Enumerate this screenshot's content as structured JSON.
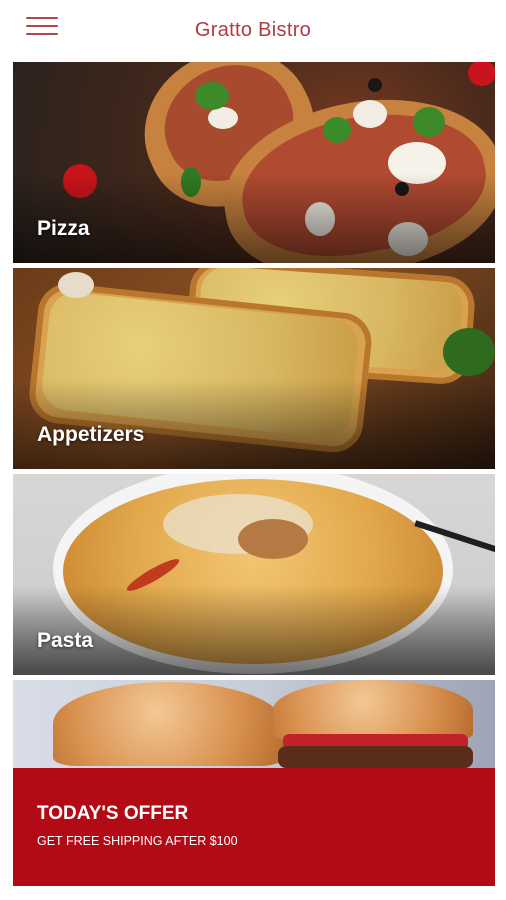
{
  "app": {
    "title": "Gratto Bistro"
  },
  "categories": [
    {
      "label": "Pizza"
    },
    {
      "label": "Appetizers"
    },
    {
      "label": "Pasta"
    }
  ],
  "offer": {
    "title": "TODAY'S OFFER",
    "subtitle": "GET FREE SHIPPING AFTER $100"
  },
  "colors": {
    "brand": "#b23a41",
    "offer_band": "#b30b15"
  },
  "icons": {
    "menu": "hamburger-menu-icon"
  }
}
